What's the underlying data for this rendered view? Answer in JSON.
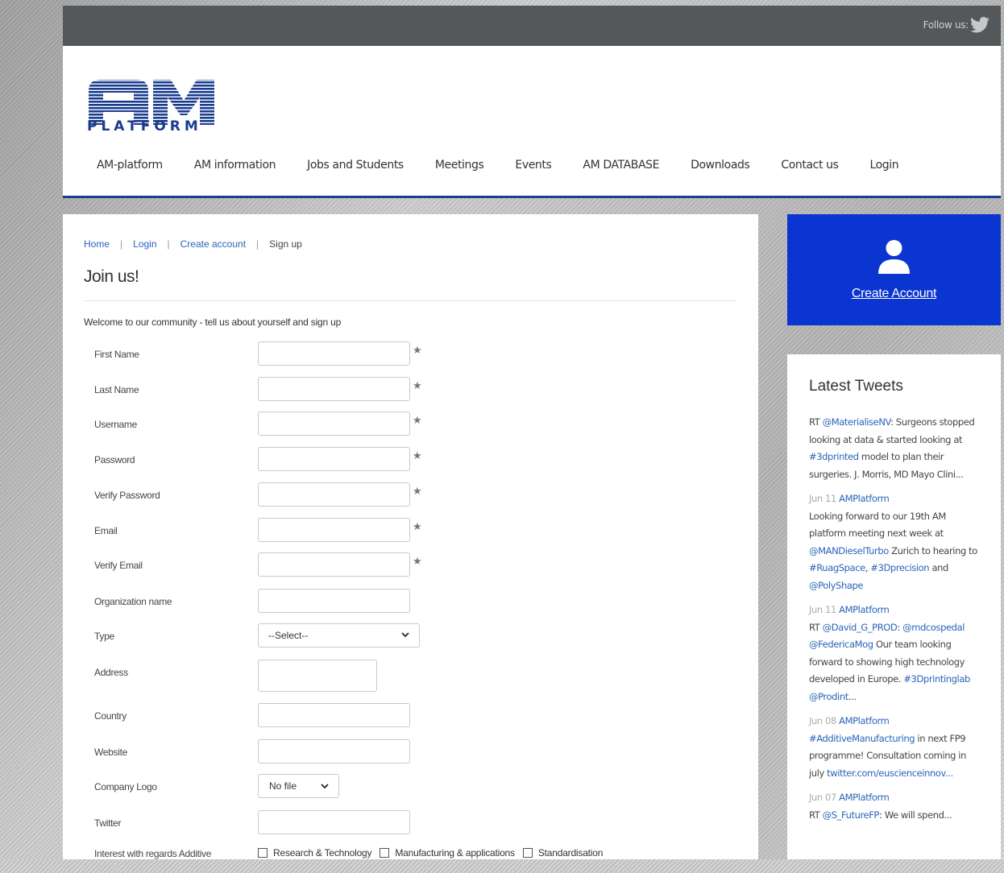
{
  "topbar": {
    "follow_label": "Follow us:"
  },
  "logo": {
    "text": "PLATFORM"
  },
  "nav": [
    "AM-platform",
    "AM information",
    "Jobs and Students",
    "Meetings",
    "Events",
    "AM DATABASE",
    "Downloads",
    "Contact us",
    "Login"
  ],
  "breadcrumb": {
    "home": "Home",
    "login": "Login",
    "create": "Create account",
    "current": "Sign up",
    "sep": "|"
  },
  "page_title": "Join us!",
  "welcome": "Welcome to our community - tell us about yourself and sign up",
  "form": {
    "first_name": "First Name",
    "last_name": "Last Name",
    "username": "Username",
    "password": "Password",
    "verify_password": "Verify Password",
    "email": "Email",
    "verify_email": "Verify Email",
    "organization": "Organization name",
    "type": "Type",
    "type_value": "--Select--",
    "address": "Address",
    "country": "Country",
    "website": "Website",
    "company_logo": "Company Logo",
    "company_logo_value": "No file",
    "twitter": "Twitter",
    "interest": "Interest with regards Additive",
    "interest_options": [
      "Research & Technology",
      "Manufacturing & applications",
      "Standardisation"
    ],
    "required_mark": "★"
  },
  "sidebar": {
    "create_account": "Create Account",
    "tweets_title": "Latest Tweets",
    "accent_color": "#0b35d0"
  },
  "tweets": [
    {
      "date": "",
      "author": "",
      "parts": [
        [
          "t",
          "RT "
        ],
        [
          "l",
          "@MaterialiseNV"
        ],
        [
          "t",
          ": Surgeons stopped looking at data & started looking at "
        ],
        [
          "l",
          "#3dprinted"
        ],
        [
          "t",
          " model to plan their surgeries. J. Morris, MD Mayo Clini..."
        ]
      ]
    },
    {
      "date": "Jun 11",
      "author": "AMPlatform",
      "parts": [
        [
          "t",
          "Looking forward to our 19th AM platform meeting next week at "
        ],
        [
          "l",
          "@MANDieselTurbo"
        ],
        [
          "t",
          " Zurich to hearing to "
        ],
        [
          "l",
          "#RuagSpace"
        ],
        [
          "t",
          ", "
        ],
        [
          "l",
          "#3Dprecision"
        ],
        [
          "t",
          " and "
        ],
        [
          "l",
          "@PolyShape"
        ]
      ]
    },
    {
      "date": "Jun 11",
      "author": "AMPlatform",
      "parts": [
        [
          "t",
          "RT "
        ],
        [
          "l",
          "@David_G_PROD"
        ],
        [
          "t",
          ": "
        ],
        [
          "l",
          "@mdcospedal"
        ],
        [
          "t",
          " "
        ],
        [
          "l",
          "@FedericaMog"
        ],
        [
          "t",
          " Our team looking forward to showing high technology developed in Europe. "
        ],
        [
          "l",
          "#3Dprintinglab"
        ],
        [
          "t",
          " "
        ],
        [
          "l",
          "@Prodint"
        ],
        [
          "t",
          "..."
        ]
      ]
    },
    {
      "date": "Jun 08",
      "author": "AMPlatform",
      "parts": [
        [
          "l",
          "#AdditiveManufacturing"
        ],
        [
          "t",
          " in next FP9 programme! Consultation coming in july "
        ],
        [
          "l",
          "twitter.com/euscienceinnov..."
        ]
      ]
    },
    {
      "date": "Jun 07",
      "author": "AMPlatform",
      "parts": [
        [
          "t",
          "RT "
        ],
        [
          "l",
          "@S_FutureFP"
        ],
        [
          "t",
          ": We will spend..."
        ]
      ]
    }
  ]
}
